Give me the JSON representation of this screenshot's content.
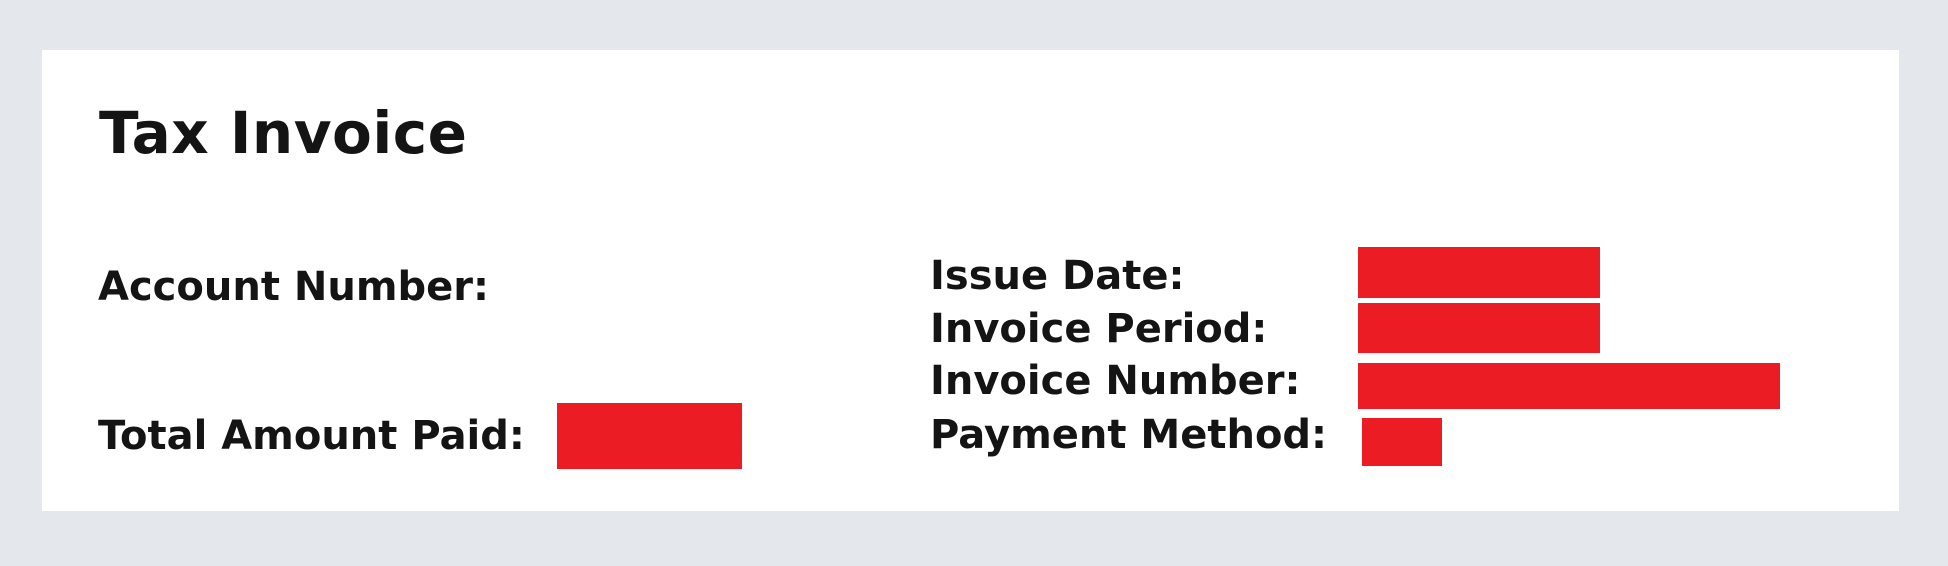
{
  "invoice": {
    "title": "Tax Invoice",
    "labels": {
      "account_number": "Account Number:",
      "total_amount_paid": "Total Amount Paid:",
      "issue_date": "Issue Date:",
      "invoice_period": "Invoice Period:",
      "invoice_number": "Invoice Number:",
      "payment_method": "Payment Method:"
    },
    "redaction_color": "#ec1c24"
  }
}
